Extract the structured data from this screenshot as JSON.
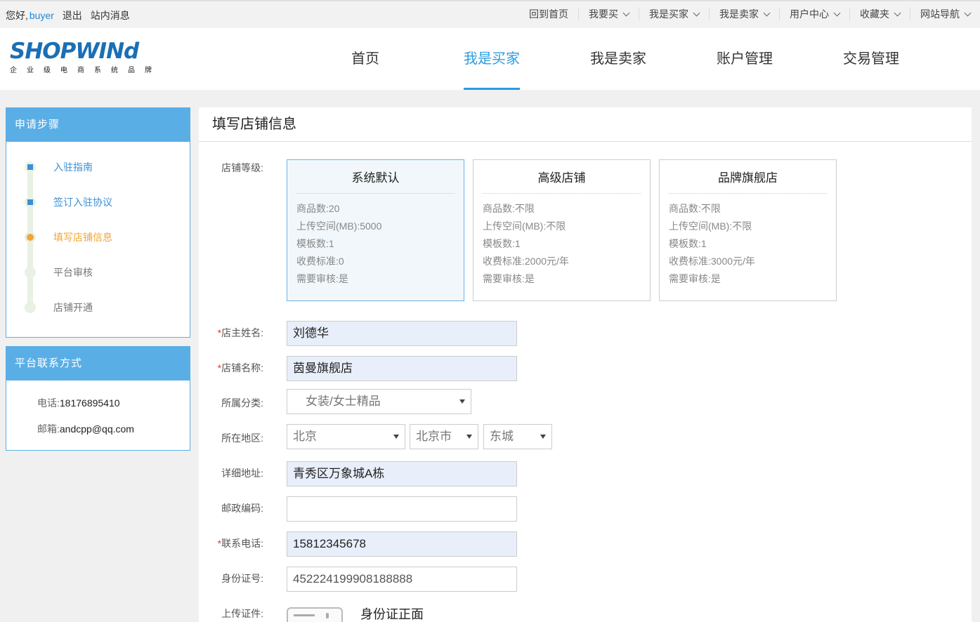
{
  "topbar": {
    "greeting": "您好,",
    "username": "buyer",
    "logout": "退出",
    "messages": "站内消息",
    "nav": [
      {
        "label": "回到首页",
        "dropdown": false
      },
      {
        "label": "我要买",
        "dropdown": true
      },
      {
        "label": "我是买家",
        "dropdown": true
      },
      {
        "label": "我是卖家",
        "dropdown": true
      },
      {
        "label": "用户中心",
        "dropdown": true
      },
      {
        "label": "收藏夹",
        "dropdown": true
      },
      {
        "label": "网站导航",
        "dropdown": true
      }
    ]
  },
  "logo": {
    "brand": "SHOPWINd",
    "tagline": "企业级电商系统品牌"
  },
  "mainnav": [
    "首页",
    "我是买家",
    "我是卖家",
    "账户管理",
    "交易管理"
  ],
  "mainnav_active": "我是买家",
  "steps_panel": {
    "title": "申请步骤",
    "steps": [
      {
        "label": "入驻指南",
        "state": "done"
      },
      {
        "label": "签订入驻协议",
        "state": "done"
      },
      {
        "label": "填写店铺信息",
        "state": "current"
      },
      {
        "label": "平台审核",
        "state": "todo"
      },
      {
        "label": "店铺开通",
        "state": "todo"
      }
    ]
  },
  "contact_panel": {
    "title": "平台联系方式",
    "phone_label": "电话:",
    "phone": "18176895410",
    "email_label": "邮箱:",
    "email": "andcpp@qq.com"
  },
  "form": {
    "title": "填写店铺信息",
    "grade_label": "店铺等级:",
    "grades": [
      {
        "name": "系统默认",
        "selected": true,
        "lines": [
          "商品数:20",
          "上传空间(MB):5000",
          "模板数:1",
          "收费标准:0",
          "需要审核:是"
        ]
      },
      {
        "name": "高级店铺",
        "selected": false,
        "lines": [
          "商品数:不限",
          "上传空间(MB):不限",
          "模板数:1",
          "收费标准:2000元/年",
          "需要审核:是"
        ]
      },
      {
        "name": "品牌旗舰店",
        "selected": false,
        "lines": [
          "商品数:不限",
          "上传空间(MB):不限",
          "模板数:1",
          "收费标准:3000元/年",
          "需要审核:是"
        ]
      }
    ],
    "owner_label": "店主姓名:",
    "owner": "刘德华",
    "store_name_label": "店铺名称:",
    "store_name": "茵曼旗舰店",
    "category_label": "所属分类:",
    "category": "女装/女士精品",
    "region_label": "所在地区:",
    "province": "北京",
    "city": "北京市",
    "district": "东城",
    "address_label": "详细地址:",
    "address": "青秀区万象城A栋",
    "zip_label": "邮政编码:",
    "zip": "",
    "phone_label": "联系电话:",
    "phone": "15812345678",
    "idno_label": "身份证号:",
    "idno": "452224199908188888",
    "upload_label": "上传证件:",
    "upload_front": "身份证正面",
    "required_mark": "*"
  },
  "colors": {
    "accent": "#2b9be2",
    "panel_header": "#5aaee6",
    "current_step": "#f0a636",
    "required": "#e33333"
  }
}
